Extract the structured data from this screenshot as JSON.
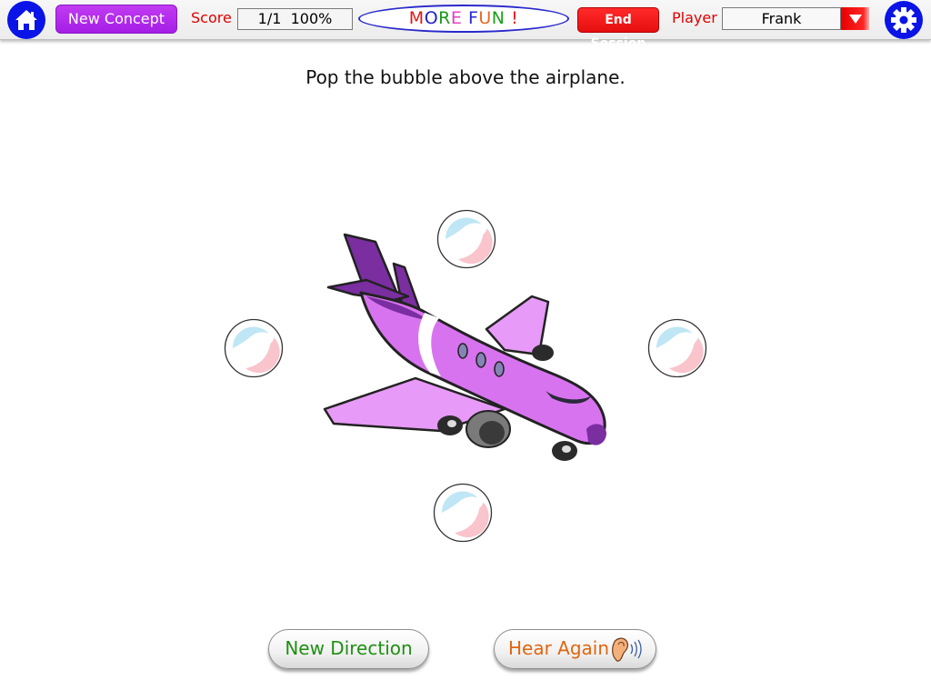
{
  "topbar": {
    "home_icon": "home-icon",
    "new_concept_label": "New Concept",
    "score_label": "Score",
    "score_value": "1/1  100%",
    "more_fun": {
      "letters": [
        {
          "ch": "M",
          "color": "#e01818"
        },
        {
          "ch": "O",
          "color": "#2020d0"
        },
        {
          "ch": "R",
          "color": "#1a9a1a"
        },
        {
          "ch": "E",
          "color": "#e040c8"
        },
        {
          "ch": " ",
          "color": "#000000"
        },
        {
          "ch": "F",
          "color": "#2828d8"
        },
        {
          "ch": "U",
          "color": "#e86a20"
        },
        {
          "ch": "N",
          "color": "#1aa01a"
        },
        {
          "ch": " ",
          "color": "#000000"
        },
        {
          "ch": "!",
          "color": "#e01818"
        }
      ]
    },
    "end_session_label": "End Session",
    "player_label": "Player",
    "player_value": "Frank",
    "settings_icon": "gear-icon"
  },
  "main": {
    "prompt": "Pop the bubble above the airplane.",
    "bubbles": [
      "above",
      "left",
      "right",
      "below"
    ],
    "center_image": "airplane",
    "colors": {
      "airplane_body": "#d873f0",
      "airplane_tail": "#7a2ea0",
      "airplane_wing": "#e79af7"
    }
  },
  "footer": {
    "new_direction_label": "New Direction",
    "hear_again_label": "Hear Again",
    "hear_again_icon": "ear-icon"
  },
  "colors": {
    "accent_blue": "#0a14e6",
    "accent_purple": "#b02aea",
    "accent_red": "#e60f0f",
    "label_red": "#e00000",
    "green_text": "#1f8f12",
    "orange_text": "#e0660f"
  }
}
